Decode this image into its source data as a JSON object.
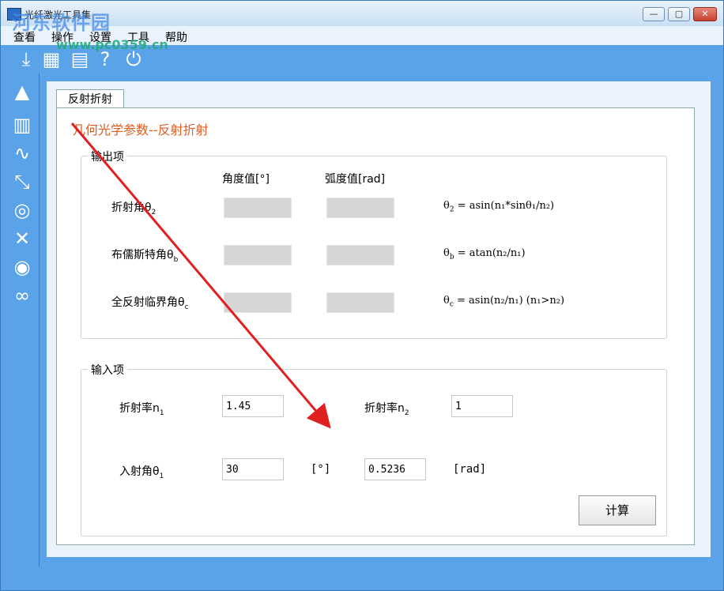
{
  "window": {
    "title": "光纤激光工具集",
    "minimize": "—",
    "maximize": "▢",
    "close": "✕"
  },
  "menu": [
    "查看",
    "操作",
    "设置",
    "工具",
    "帮助"
  ],
  "watermark": {
    "line1": "河东软件园",
    "line2": "www.pc0359.cn"
  },
  "tab": {
    "label": "反射折射"
  },
  "heading": "几何光学参数--反射折射",
  "output": {
    "title": "输出项",
    "col_degree": "角度值[°]",
    "col_radian": "弧度值[rad]",
    "rows": [
      {
        "label": "折射角θ",
        "sub": "2",
        "f_pre": "θ",
        "f_sub": "2",
        "f_rest": " = asin(n₁*sinθ₁/n₂)"
      },
      {
        "label": "布儒斯特角θ",
        "sub": "b",
        "f_pre": "θ",
        "f_sub": "b",
        "f_rest": " = atan(n₂/n₁)"
      },
      {
        "label": "全反射临界角θ",
        "sub": "c",
        "f_pre": "θ",
        "f_sub": "c",
        "f_rest": " = asin(n₂/n₁) (n₁>n₂)"
      }
    ]
  },
  "input": {
    "title": "输入项",
    "n1_label": "折射率n",
    "n1_sub": "1",
    "n1_value": "1.45",
    "n2_label": "折射率n",
    "n2_sub": "2",
    "n2_value": "1",
    "theta_label": "入射角θ",
    "theta_sub": "1",
    "theta_deg": "30",
    "deg_unit": "[°]",
    "theta_rad": "0.5236",
    "rad_unit": "[rad]"
  },
  "calc_button": "计算",
  "colors": {
    "accent": "#5aa3e8",
    "heading": "#e25b21",
    "arrow": "#e02020"
  }
}
